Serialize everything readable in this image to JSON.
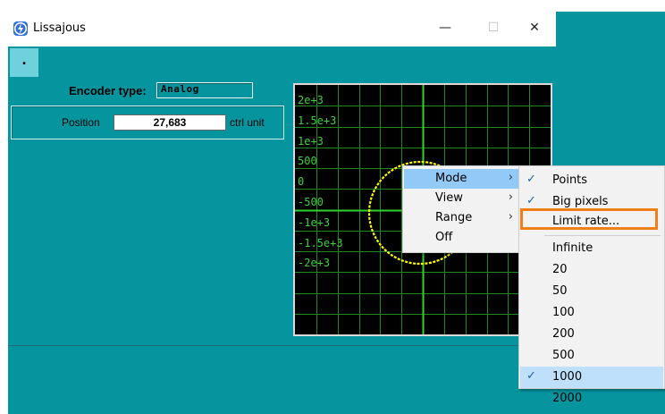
{
  "window": {
    "title": "Lissajous",
    "title_buttons": {
      "minimize": "—",
      "maximize": "☐",
      "close": "✕"
    },
    "dot_button": "."
  },
  "encoder": {
    "label": "Encoder type:",
    "value": "Analog"
  },
  "position": {
    "label": "Position",
    "value": "27,683",
    "unit": "ctrl unit"
  },
  "plot": {
    "y_tick_labels": [
      "2e+3",
      "1.5e+3",
      "1e+3",
      "500",
      "0",
      "-500",
      "-1e+3",
      "-1.5e+3",
      "-2e+3"
    ],
    "grid_color": "#1f8a1f",
    "axis_color": "#2fd32f",
    "trace_color": "#ffff00"
  },
  "context_menu": {
    "items": [
      {
        "label": "Mode",
        "submenu": true,
        "highlighted": true
      },
      {
        "label": "View",
        "submenu": true
      },
      {
        "label": "Range",
        "submenu": true
      },
      {
        "label": "Off",
        "submenu": false
      }
    ]
  },
  "mode_submenu": {
    "items": [
      {
        "label": "Points",
        "checked": true
      },
      {
        "label": "Big pixels",
        "checked": true
      },
      {
        "label": "Limit rate...",
        "checked": false,
        "outlined": true
      }
    ],
    "rates": [
      {
        "label": "Infinite",
        "checked": false
      },
      {
        "label": "20",
        "checked": false
      },
      {
        "label": "50",
        "checked": false
      },
      {
        "label": "100",
        "checked": false
      },
      {
        "label": "200",
        "checked": false
      },
      {
        "label": "500",
        "checked": false
      },
      {
        "label": "1000",
        "checked": true
      },
      {
        "label": "2000",
        "checked": false
      }
    ],
    "check_glyph": "✓",
    "highlight_color": "#f07f1a"
  }
}
